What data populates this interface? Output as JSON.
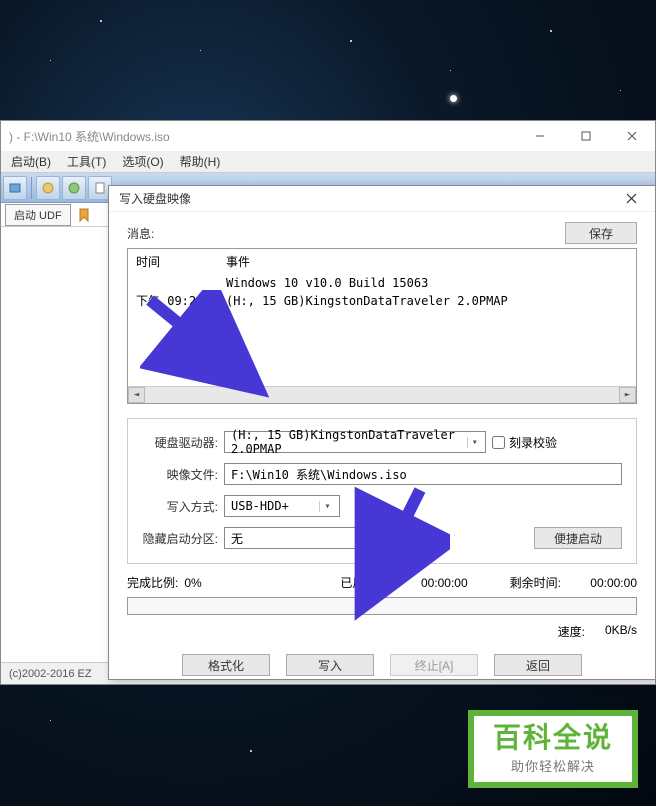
{
  "main_window": {
    "title": ") - F:\\Win10 系统\\Windows.iso",
    "menu": {
      "boot": "启动(B)",
      "tools": "工具(T)",
      "options": "选项(O)",
      "help": "帮助(H)"
    },
    "tab_label": "启动 UDF",
    "statusbar": "(c)2002-2016 EZ"
  },
  "dialog": {
    "title": "写入硬盘映像",
    "messages_label": "消息:",
    "save_btn": "保存",
    "log": {
      "header_time": "时间",
      "header_event": "事件",
      "rows": [
        {
          "time": "",
          "event": "Windows 10 v10.0 Build 15063"
        },
        {
          "time": "下午 09:28:24",
          "event": "(H:, 15 GB)KingstonDataTraveler 2.0PMAP"
        }
      ]
    },
    "form": {
      "drive_label": "硬盘驱动器:",
      "drive_value": "(H:, 15 GB)KingstonDataTraveler 2.0PMAP",
      "verify_label": "刻录校验",
      "image_label": "映像文件:",
      "image_value": "F:\\Win10 系统\\Windows.iso",
      "write_mode_label": "写入方式:",
      "write_mode_value": "USB-HDD+",
      "hidden_boot_label": "隐藏启动分区:",
      "hidden_boot_value": "无",
      "quick_boot_btn": "便捷启动"
    },
    "stats": {
      "progress_label": "完成比例:",
      "progress_value": "0%",
      "elapsed_label": "已用时间:",
      "elapsed_value": "00:00:00",
      "remaining_label": "剩余时间:",
      "remaining_value": "00:00:00",
      "speed_label": "速度:",
      "speed_value": "0KB/s"
    },
    "buttons": {
      "format": "格式化",
      "write": "写入",
      "stop": "终止[A]",
      "back": "返回"
    }
  },
  "watermark": {
    "big": "百科全说",
    "small": "助你轻松解决"
  }
}
